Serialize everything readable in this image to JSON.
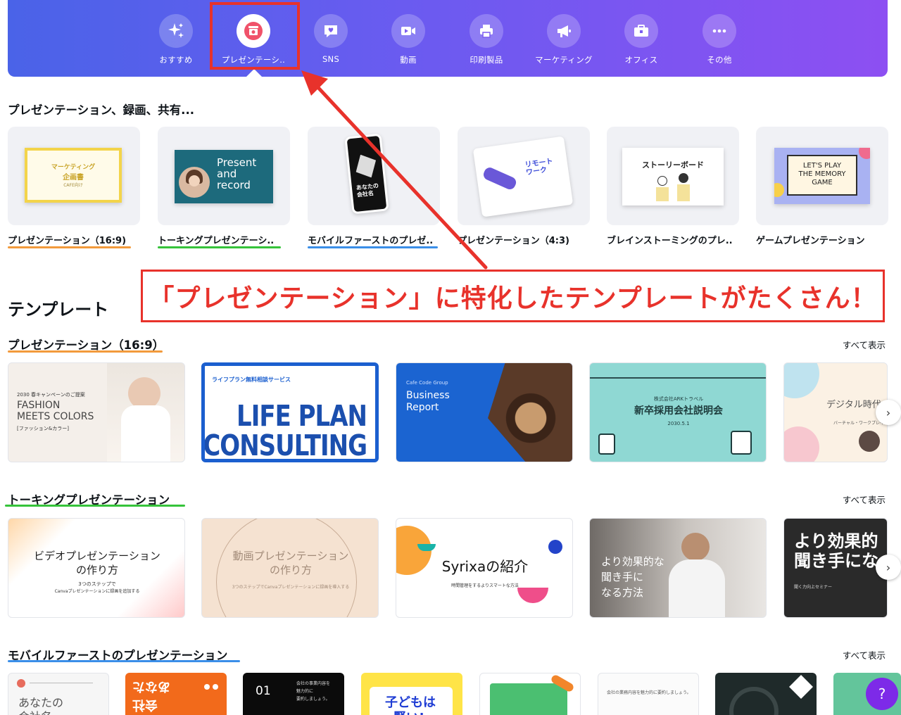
{
  "nav": {
    "items": [
      {
        "label": "おすすめ",
        "icon": "sparkle-icon"
      },
      {
        "label": "プレゼンテーシ..",
        "icon": "presentation-icon",
        "active": true
      },
      {
        "label": "SNS",
        "icon": "heart-chat-icon"
      },
      {
        "label": "動画",
        "icon": "video-icon"
      },
      {
        "label": "印刷製品",
        "icon": "printer-icon"
      },
      {
        "label": "マーケティング",
        "icon": "megaphone-icon"
      },
      {
        "label": "オフィス",
        "icon": "briefcase-icon"
      },
      {
        "label": "その他",
        "icon": "more-icon"
      }
    ]
  },
  "section_types": {
    "title": "プレゼンテーション、録画、共有...",
    "items": [
      {
        "label": "プレゼンテーション（16:9)",
        "underline": "#f29a3c",
        "mini": {
          "line1": "マーケティング",
          "line2": "企画書",
          "line3": "CAFE向け"
        }
      },
      {
        "label": "トーキングプレゼンテーシ..",
        "underline": "#35c33a",
        "mini": {
          "line1": "Present",
          "line2": "and",
          "line3": "record"
        }
      },
      {
        "label": "モバイルファーストのプレゼ..",
        "underline": "#3a8ee8",
        "mini": {
          "line1": "あなたの",
          "line2": "会社名"
        }
      },
      {
        "label": "プレゼンテーション（4:3)",
        "underline": "",
        "mini": {
          "line1": "リモート",
          "line2": "ワーク"
        }
      },
      {
        "label": "ブレインストーミングのプレ..",
        "underline": "",
        "mini": {
          "line1": "ストーリーボード"
        }
      },
      {
        "label": "ゲームプレゼンテーション",
        "underline": "",
        "mini": {
          "line1": "LET'S PLAY",
          "line2": "THE MEMORY",
          "line3": "GAME"
        }
      }
    ]
  },
  "annotation": {
    "text": "「プレゼンテーション」に特化したテンプレートがたくさん！",
    "color": "#e8322b"
  },
  "templates_heading": "テンプレート",
  "see_all": "すべて表示",
  "row1": {
    "title": "プレゼンテーション（16:9）",
    "cards": [
      {
        "t1": "2030 春キャンペーンのご提案",
        "t2": "FASHION",
        "t3": "MEETS COLORS",
        "t4": "[ファッション&カラー]"
      },
      {
        "t1": "ライフプラン無料相談サービス",
        "t2": "LIFE PLAN",
        "t3": "CONSULTING"
      },
      {
        "t1": "Cafe Code Group",
        "t2": "Business",
        "t3": "Report"
      },
      {
        "t1": "株式会社ARKトラベル",
        "t2": "新卒採用会社説明会",
        "t3": "2030.5.1"
      },
      {
        "t1": "デジタル時代",
        "t2": "バーチャル・ワークプレイス"
      }
    ]
  },
  "row2": {
    "title": "トーキングプレゼンテーション",
    "cards": [
      {
        "t1": "ビデオプレゼンテーション",
        "t2": "の作り方",
        "t3": "3つのステップで",
        "t4": "Canvaプレゼンテーションに録画を追加する"
      },
      {
        "t1": "動画プレゼンテーション",
        "t2": "の作り方",
        "t3": "3つのステップでCanvaプレゼンテーションに録画を導入する"
      },
      {
        "t1": "Syrixaの紹介",
        "t2": "時間管理をするよりスマートな方法"
      },
      {
        "t1": "より効果的な",
        "t2": "聞き手に",
        "t3": "なる方法"
      },
      {
        "t1": "より効果的",
        "t2": "聞き手にな",
        "t3": "聞く力向上セミナー"
      }
    ]
  },
  "row3": {
    "title": "モバイルファーストのプレゼンテーション",
    "cards": [
      {
        "t1": "あなたの",
        "t2": "会社名"
      },
      {
        "t1": "あなた",
        "t2": "会社"
      },
      {
        "t1": "01",
        "t2": "会社の事業内容を",
        "t3": "魅力的に",
        "t4": "要約しましょう。"
      },
      {
        "t1": "子どもは",
        "t2": "賢い!"
      },
      {
        "t1": ""
      },
      {
        "t1": "会社の業務内容を魅力的に要約しましょう。"
      },
      {
        "t1": ""
      },
      {
        "t1": ""
      }
    ]
  },
  "help_label": "?"
}
